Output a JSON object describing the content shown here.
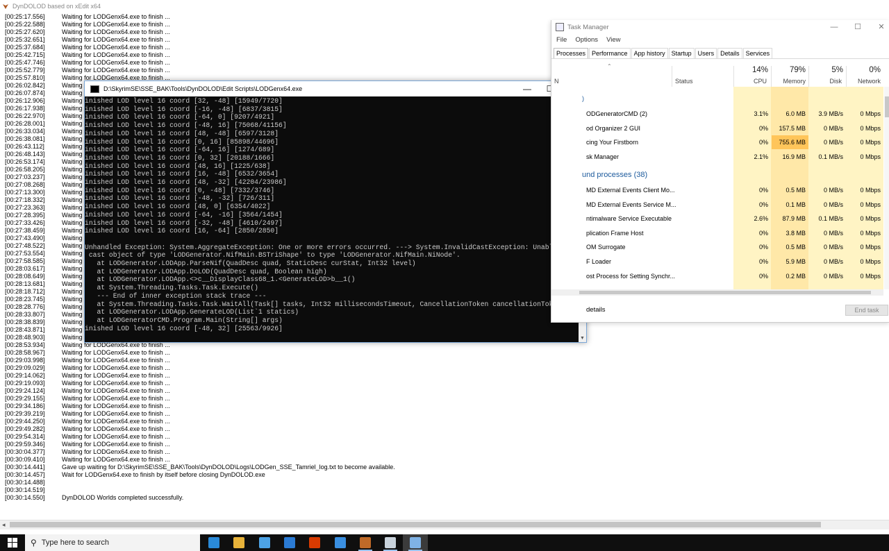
{
  "dyndolod": {
    "title": "DynDOLOD based on xEdit x64",
    "log": [
      {
        "ts": "[00:25:17.556]",
        "msg": "Waiting for LODGenx64.exe to finish ..."
      },
      {
        "ts": "[00:25:22.588]",
        "msg": "Waiting for LODGenx64.exe to finish ..."
      },
      {
        "ts": "[00:25:27.620]",
        "msg": "Waiting for LODGenx64.exe to finish ..."
      },
      {
        "ts": "[00:25:32.651]",
        "msg": "Waiting for LODGenx64.exe to finish ..."
      },
      {
        "ts": "[00:25:37.684]",
        "msg": "Waiting for LODGenx64.exe to finish ..."
      },
      {
        "ts": "[00:25:42.715]",
        "msg": "Waiting for LODGenx64.exe to finish ..."
      },
      {
        "ts": "[00:25:47.746]",
        "msg": "Waiting for LODGenx64.exe to finish ..."
      },
      {
        "ts": "[00:25:52.779]",
        "msg": "Waiting for LODGenx64.exe to finish ..."
      },
      {
        "ts": "[00:25:57.810]",
        "msg": "Waiting for LODGenx64.exe to finish ..."
      },
      {
        "ts": "[00:26:02.842]",
        "msg": "Waiting"
      },
      {
        "ts": "[00:26:07.874]",
        "msg": "Waiting"
      },
      {
        "ts": "[00:26:12.906]",
        "msg": "Waiting"
      },
      {
        "ts": "[00:26:17.938]",
        "msg": "Waiting"
      },
      {
        "ts": "[00:26:22.970]",
        "msg": "Waiting"
      },
      {
        "ts": "[00:26:28.001]",
        "msg": "Waiting"
      },
      {
        "ts": "[00:26:33.034]",
        "msg": "Waiting"
      },
      {
        "ts": "[00:26:38.081]",
        "msg": "Waiting"
      },
      {
        "ts": "[00:26:43.112]",
        "msg": "Waiting"
      },
      {
        "ts": "[00:26:48.143]",
        "msg": "Waiting"
      },
      {
        "ts": "[00:26:53.174]",
        "msg": "Waiting"
      },
      {
        "ts": "[00:26:58.205]",
        "msg": "Waiting"
      },
      {
        "ts": "[00:27:03.237]",
        "msg": "Waiting"
      },
      {
        "ts": "[00:27:08.268]",
        "msg": "Waiting"
      },
      {
        "ts": "[00:27:13.300]",
        "msg": "Waiting"
      },
      {
        "ts": "[00:27:18.332]",
        "msg": "Waiting"
      },
      {
        "ts": "[00:27:23.363]",
        "msg": "Waiting"
      },
      {
        "ts": "[00:27:28.395]",
        "msg": "Waiting"
      },
      {
        "ts": "[00:27:33.426]",
        "msg": "Waiting"
      },
      {
        "ts": "[00:27:38.459]",
        "msg": "Waiting"
      },
      {
        "ts": "[00:27:43.490]",
        "msg": "Waiting"
      },
      {
        "ts": "[00:27:48.522]",
        "msg": "Waiting"
      },
      {
        "ts": "[00:27:53.554]",
        "msg": "Waiting"
      },
      {
        "ts": "[00:27:58.585]",
        "msg": "Waiting"
      },
      {
        "ts": "[00:28:03.617]",
        "msg": "Waiting"
      },
      {
        "ts": "[00:28:08.649]",
        "msg": "Waiting"
      },
      {
        "ts": "[00:28:13.681]",
        "msg": "Waiting"
      },
      {
        "ts": "[00:28:18.712]",
        "msg": "Waiting"
      },
      {
        "ts": "[00:28:23.745]",
        "msg": "Waiting"
      },
      {
        "ts": "[00:28:28.776]",
        "msg": "Waiting"
      },
      {
        "ts": "[00:28:33.807]",
        "msg": "Waiting"
      },
      {
        "ts": "[00:28:38.839]",
        "msg": "Waiting"
      },
      {
        "ts": "[00:28:43.871]",
        "msg": "Waiting"
      },
      {
        "ts": "[00:28:48.903]",
        "msg": "Waiting for LODGenx64.exe to finish ..."
      },
      {
        "ts": "[00:28:53.934]",
        "msg": "Waiting for LODGenx64.exe to finish ..."
      },
      {
        "ts": "[00:28:58.967]",
        "msg": "Waiting for LODGenx64.exe to finish ..."
      },
      {
        "ts": "[00:29:03.998]",
        "msg": "Waiting for LODGenx64.exe to finish ..."
      },
      {
        "ts": "[00:29:09.029]",
        "msg": "Waiting for LODGenx64.exe to finish ..."
      },
      {
        "ts": "[00:29:14.062]",
        "msg": "Waiting for LODGenx64.exe to finish ..."
      },
      {
        "ts": "[00:29:19.093]",
        "msg": "Waiting for LODGenx64.exe to finish ..."
      },
      {
        "ts": "[00:29:24.124]",
        "msg": "Waiting for LODGenx64.exe to finish ..."
      },
      {
        "ts": "[00:29:29.155]",
        "msg": "Waiting for LODGenx64.exe to finish ..."
      },
      {
        "ts": "[00:29:34.186]",
        "msg": "Waiting for LODGenx64.exe to finish ..."
      },
      {
        "ts": "[00:29:39.219]",
        "msg": "Waiting for LODGenx64.exe to finish ..."
      },
      {
        "ts": "[00:29:44.250]",
        "msg": "Waiting for LODGenx64.exe to finish ..."
      },
      {
        "ts": "[00:29:49.282]",
        "msg": "Waiting for LODGenx64.exe to finish ..."
      },
      {
        "ts": "[00:29:54.314]",
        "msg": "Waiting for LODGenx64.exe to finish ..."
      },
      {
        "ts": "[00:29:59.346]",
        "msg": "Waiting for LODGenx64.exe to finish ..."
      },
      {
        "ts": "[00:30:04.377]",
        "msg": "Waiting for LODGenx64.exe to finish ..."
      },
      {
        "ts": "[00:30:09.410]",
        "msg": "Waiting for LODGenx64.exe to finish ..."
      },
      {
        "ts": "[00:30:14.441]",
        "msg": "Gave up waiting for D:\\SkyrimSE\\SSE_BAK\\Tools\\DynDOLOD\\Logs\\LODGen_SSE_Tamriel_log.txt to become available."
      },
      {
        "ts": "[00:30:14.457]",
        "msg": "   Wait for LODGenx64.exe to finish by itself before closing DynDOLOD.exe"
      },
      {
        "ts": "[00:30:14.488]",
        "msg": ""
      },
      {
        "ts": "[00:30:14.519]",
        "msg": ""
      },
      {
        "ts": "[00:30:14.550]",
        "msg": "DynDOLOD Worlds completed successfully."
      }
    ]
  },
  "console": {
    "title": "D:\\SkyrimSE\\SSE_BAK\\Tools\\DynDOLOD\\Edit Scripts\\LODGenx64.exe",
    "lines": [
      "inished LOD level 16 coord [32, -48] [15949/7720]",
      "inished LOD level 16 coord [-16, -48] [6837/3815]",
      "inished LOD level 16 coord [-64, 0] [9207/4921]",
      "inished LOD level 16 coord [-48, 16] [75068/41156]",
      "inished LOD level 16 coord [48, -48] [6597/3128]",
      "inished LOD level 16 coord [0, 16] [85898/44696]",
      "inished LOD level 16 coord [-64, 16] [1274/689]",
      "inished LOD level 16 coord [0, 32] [20188/1666]",
      "inished LOD level 16 coord [48, 16] [1225/638]",
      "inished LOD level 16 coord [16, -48] [6532/3654]",
      "inished LOD level 16 coord [48, -32] [42204/23986]",
      "inished LOD level 16 coord [0, -48] [7332/3746]",
      "inished LOD level 16 coord [-48, -32] [726/311]",
      "inished LOD level 16 coord [48, 0] [6354/4022]",
      "inished LOD level 16 coord [-64, -16] [3564/1454]",
      "inished LOD level 16 coord [-32, -48] [4610/2497]",
      "inished LOD level 16 coord [16, -64] [2850/2850]",
      "",
      "Unhandled Exception: System.AggregateException: One or more errors occurred. ---> System.InvalidCastException: Unable to",
      " cast object of type 'LODGenerator.NifMain.BSTriShape' to type 'LODGenerator.NifMain.NiNode'.",
      "   at LODGenerator.LODApp.ParseNif(QuadDesc quad, StaticDesc curStat, Int32 level)",
      "   at LODGenerator.LODApp.DoLOD(QuadDesc quad, Boolean high)",
      "   at LODGenerator.LODApp.<>c__DisplayClass68_1.<GenerateLOD>b__1()",
      "   at System.Threading.Tasks.Task.Execute()",
      "   --- End of inner exception stack trace ---",
      "   at System.Threading.Tasks.Task.WaitAll(Task[] tasks, Int32 millisecondsTimeout, CancellationToken cancellationToken)",
      "   at LODGenerator.LODApp.GenerateLOD(List`1 statics)",
      "   at LODGeneratorCMD.Program.Main(String[] args)",
      "inished LOD level 16 coord [-48, 32] [25563/9926]"
    ]
  },
  "taskmanager": {
    "title": "Task Manager",
    "menu": [
      "File",
      "Options",
      "View"
    ],
    "tabs": [
      "Processes",
      "Performance",
      "App history",
      "Startup",
      "Users",
      "Details",
      "Services"
    ],
    "header": {
      "name": "N",
      "status": "Status",
      "cpu_pct": "14%",
      "cpu": "CPU",
      "mem_pct": "79%",
      "mem": "Memory",
      "disk_pct": "5%",
      "disk": "Disk",
      "net_pct": "0%",
      "net": "Network"
    },
    "apps_arrow": ")",
    "apps": [
      {
        "name": "ODGeneratorCMD (2)",
        "cpu": "3.1%",
        "mem": "6.0 MB",
        "disk": "3.9 MB/s",
        "net": "0 Mbps"
      },
      {
        "name": "od Organizer 2 GUI",
        "cpu": "0%",
        "mem": "157.5 MB",
        "disk": "0 MB/s",
        "net": "0 Mbps"
      },
      {
        "name": "cing Your Firstborn",
        "cpu": "0%",
        "mem": "755.6 MB",
        "disk": "0 MB/s",
        "net": "0 Mbps"
      },
      {
        "name": "sk Manager",
        "cpu": "2.1%",
        "mem": "16.9 MB",
        "disk": "0.1 MB/s",
        "net": "0 Mbps"
      }
    ],
    "bg_group": "und processes (38)",
    "bg": [
      {
        "name": "MD External Events Client Mo...",
        "cpu": "0%",
        "mem": "0.5 MB",
        "disk": "0 MB/s",
        "net": "0 Mbps"
      },
      {
        "name": "MD External Events Service M...",
        "cpu": "0%",
        "mem": "0.1 MB",
        "disk": "0 MB/s",
        "net": "0 Mbps"
      },
      {
        "name": "ntimalware Service Executable",
        "cpu": "2.6%",
        "mem": "87.9 MB",
        "disk": "0.1 MB/s",
        "net": "0 Mbps"
      },
      {
        "name": "plication Frame Host",
        "cpu": "0%",
        "mem": "3.8 MB",
        "disk": "0 MB/s",
        "net": "0 Mbps"
      },
      {
        "name": "OM Surrogate",
        "cpu": "0%",
        "mem": "0.5 MB",
        "disk": "0 MB/s",
        "net": "0 Mbps"
      },
      {
        "name": "F Loader",
        "cpu": "0%",
        "mem": "5.9 MB",
        "disk": "0 MB/s",
        "net": "0 Mbps"
      },
      {
        "name": "ost Process for Setting Synchr...",
        "cpu": "0%",
        "mem": "0.2 MB",
        "disk": "0 MB/s",
        "net": "0 Mbps"
      }
    ],
    "details_label": "details",
    "end_task": "End task"
  },
  "taskbar": {
    "search_placeholder": "Type here to search",
    "apps": [
      {
        "name": "edge",
        "color": "#2a8ad8"
      },
      {
        "name": "file-explorer",
        "color": "#e8b33a"
      },
      {
        "name": "store",
        "color": "#4da3e6"
      },
      {
        "name": "mail",
        "color": "#2b7bd4"
      },
      {
        "name": "office",
        "color": "#d83b01"
      },
      {
        "name": "onedrive",
        "color": "#3a8fe0"
      },
      {
        "name": "xedit",
        "color": "#c06a28"
      },
      {
        "name": "photos",
        "color": "#c9d3dc"
      },
      {
        "name": "task-manager",
        "color": "#7fb2e5"
      }
    ]
  },
  "colors": {
    "console_bg": "#0c0c0c",
    "console_text": "#cccccc",
    "tm_cpu_band": "#fff4c4",
    "tm_mem_band": "#ffe8a8",
    "tm_mem_highlight": "#ffc55a",
    "tm_group_blue": "#1c5a9c"
  }
}
